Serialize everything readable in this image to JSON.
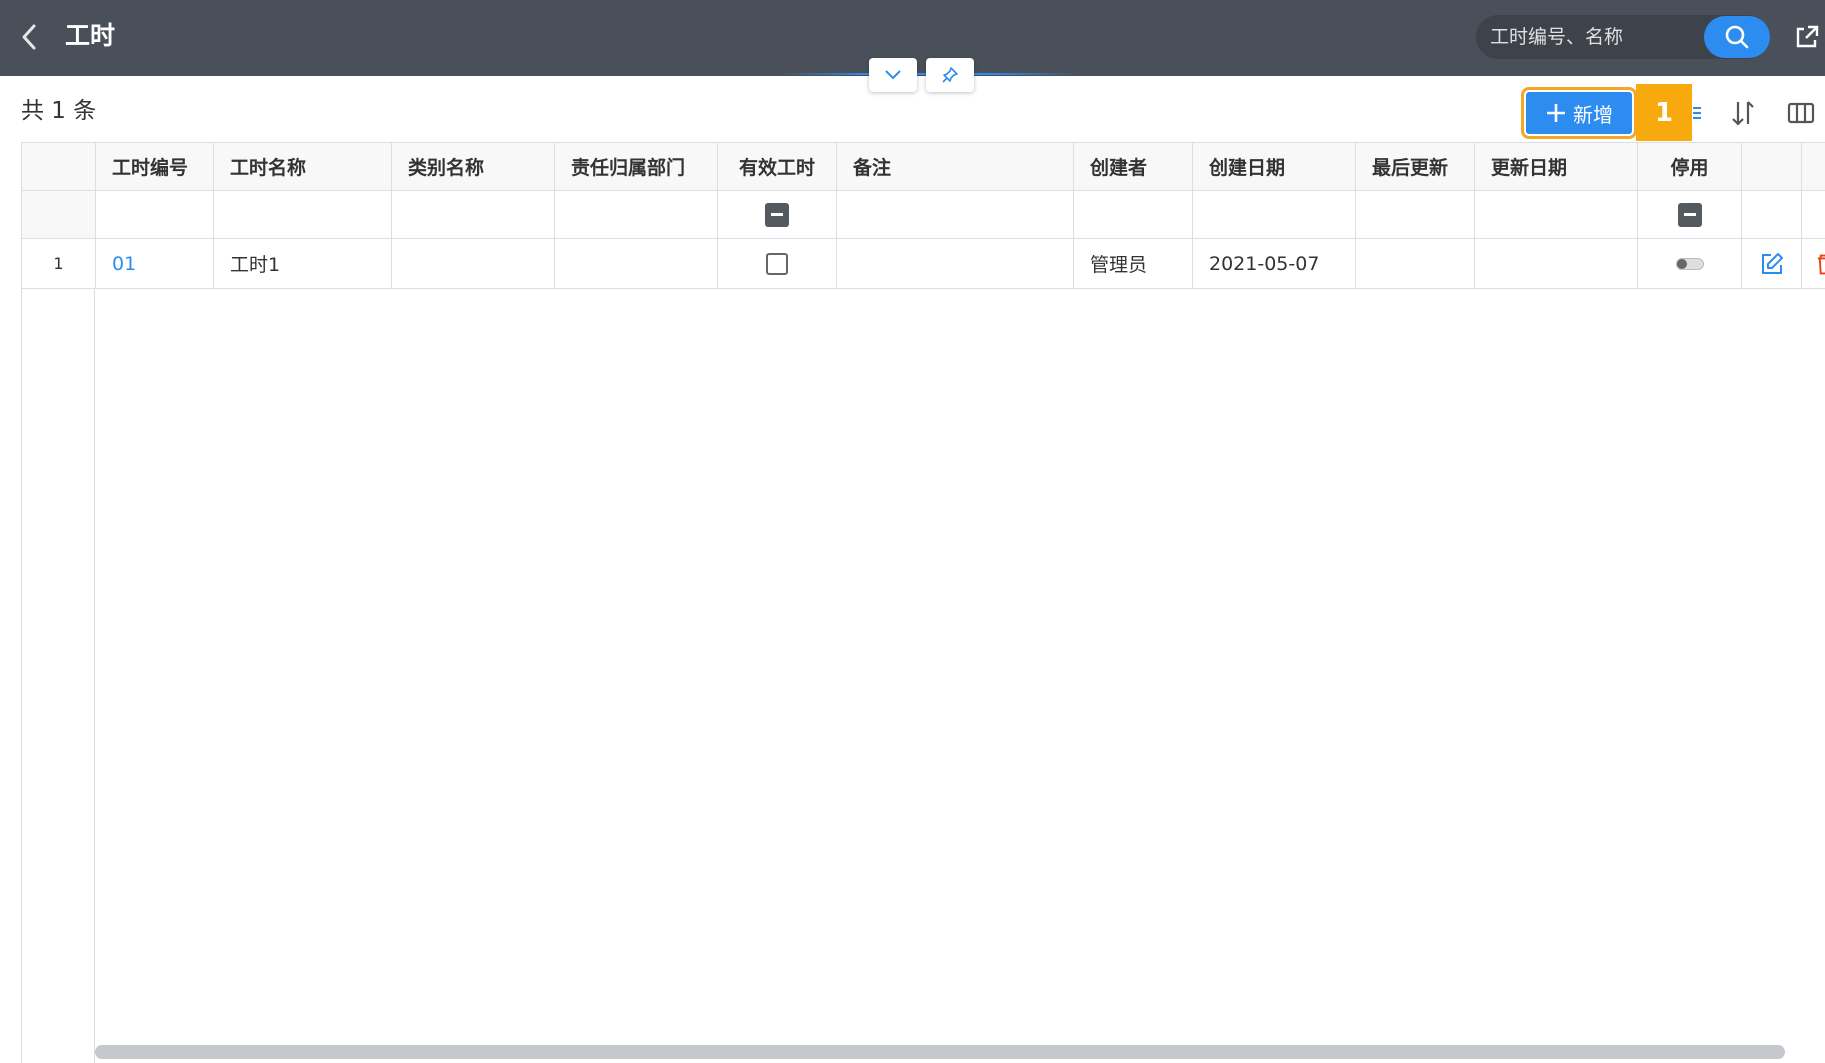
{
  "header": {
    "title": "工时",
    "search_placeholder": "工时编号、名称",
    "icons": {
      "back": "chevron-left-icon",
      "search": "search-icon",
      "export": "external-link-icon",
      "collapse": "chevron-down-icon",
      "pin": "pin-icon"
    }
  },
  "toolbar": {
    "total_label": "共 1 条",
    "add_label": "新增",
    "callout_number": "1",
    "icons": [
      "filter-icon",
      "sort-icon",
      "columns-icon"
    ]
  },
  "table": {
    "columns": [
      "工时编号",
      "工时名称",
      "类别名称",
      "责任归属部门",
      "有效工时",
      "备注",
      "创建者",
      "创建日期",
      "最后更新",
      "更新日期",
      "停用"
    ],
    "rows": [
      {
        "index": "1",
        "code": "01",
        "name": "工时1",
        "category": "",
        "department": "",
        "valid_hours": false,
        "remark": "",
        "creator": "管理员",
        "created_date": "2021-05-07",
        "last_updater": "",
        "updated_date": "",
        "disabled": false
      }
    ]
  },
  "colors": {
    "topbar": "#4a5059",
    "accent": "#2d8cf0",
    "callout": "#f7a90d",
    "delete": "#ed4014"
  }
}
